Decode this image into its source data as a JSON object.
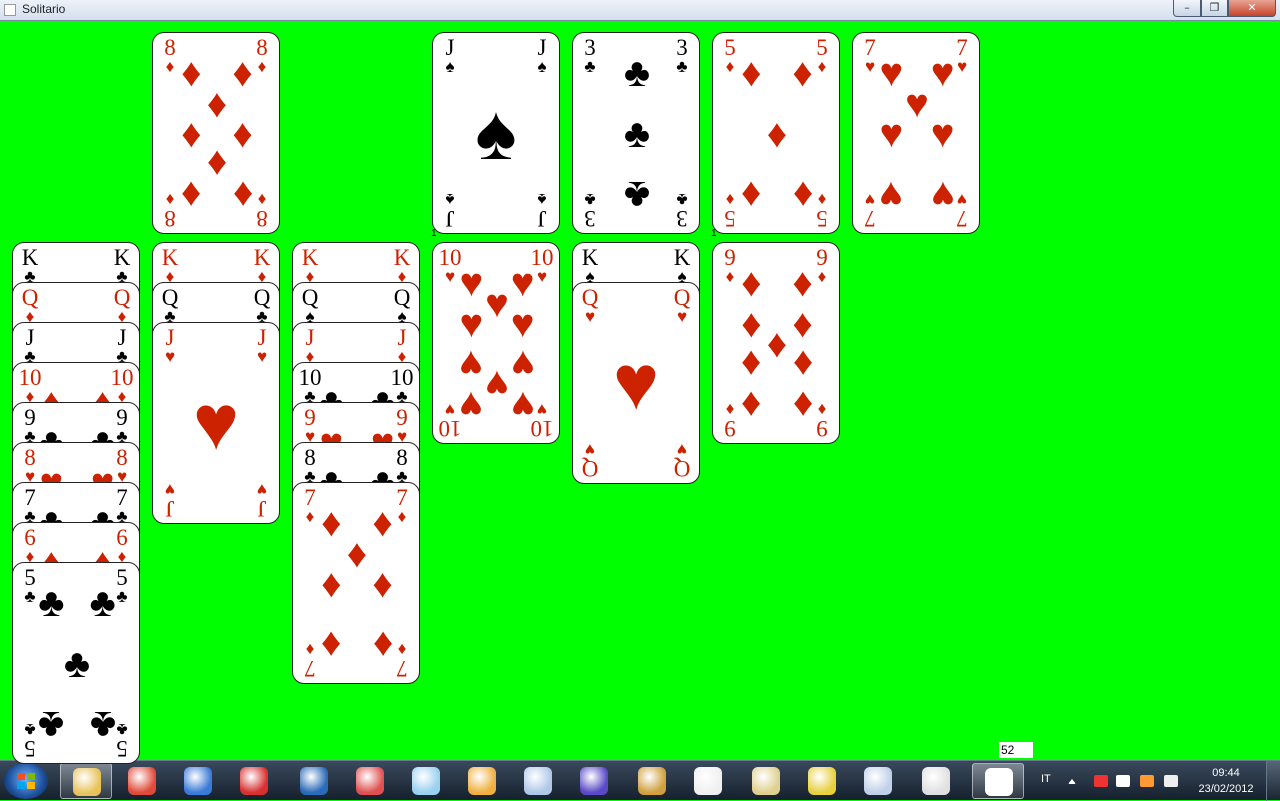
{
  "window": {
    "title": "Solitario",
    "minimize_icon": "minimize-icon",
    "maximize_icon": "restore-icon",
    "close_icon": "close-icon",
    "close_glyph": "✕",
    "min_glyph": "–",
    "max_glyph": "❐"
  },
  "colors": {
    "felt": "#00ff00",
    "red_suit": "#cc2200",
    "black_suit": "#000000"
  },
  "foundation": [
    {
      "rank": "8",
      "suit": "♦",
      "color": "red"
    },
    {
      "rank": "J",
      "suit": "♠",
      "color": "black",
      "count": "1"
    },
    {
      "rank": "3",
      "suit": "♣",
      "color": "black"
    },
    {
      "rank": "5",
      "suit": "♦",
      "color": "red",
      "count": "1"
    },
    {
      "rank": "7",
      "suit": "♥",
      "color": "red"
    }
  ],
  "tableau": [
    [
      {
        "rank": "K",
        "suit": "♣",
        "color": "black"
      },
      {
        "rank": "Q",
        "suit": "♦",
        "color": "red"
      },
      {
        "rank": "J",
        "suit": "♣",
        "color": "black"
      },
      {
        "rank": "10",
        "suit": "♦",
        "color": "red"
      },
      {
        "rank": "9",
        "suit": "♣",
        "color": "black"
      },
      {
        "rank": "8",
        "suit": "♥",
        "color": "red"
      },
      {
        "rank": "7",
        "suit": "♣",
        "color": "black"
      },
      {
        "rank": "6",
        "suit": "♦",
        "color": "red"
      },
      {
        "rank": "5",
        "suit": "♣",
        "color": "black"
      }
    ],
    [
      {
        "rank": "K",
        "suit": "♦",
        "color": "red"
      },
      {
        "rank": "Q",
        "suit": "♣",
        "color": "black"
      },
      {
        "rank": "J",
        "suit": "♥",
        "color": "red"
      }
    ],
    [
      {
        "rank": "K",
        "suit": "♦",
        "color": "red"
      },
      {
        "rank": "Q",
        "suit": "♠",
        "color": "black"
      },
      {
        "rank": "J",
        "suit": "♦",
        "color": "red"
      },
      {
        "rank": "10",
        "suit": "♣",
        "color": "black"
      },
      {
        "rank": "9",
        "suit": "♥",
        "color": "red"
      },
      {
        "rank": "8",
        "suit": "♣",
        "color": "black"
      },
      {
        "rank": "7",
        "suit": "♦",
        "color": "red"
      }
    ],
    [
      {
        "rank": "10",
        "suit": "♥",
        "color": "red"
      }
    ],
    [
      {
        "rank": "K",
        "suit": "♠",
        "color": "black"
      },
      {
        "rank": "Q",
        "suit": "♥",
        "color": "red"
      }
    ],
    [
      {
        "rank": "9",
        "suit": "♦",
        "color": "red"
      }
    ]
  ],
  "counter": "52",
  "taskbar": {
    "start_icon": "windows-start-icon",
    "apps": [
      {
        "name": "explorer-icon",
        "color": "#e8c25a"
      },
      {
        "name": "chrome-icon",
        "color": "#e04a3a"
      },
      {
        "name": "itunes-icon",
        "color": "#3a7ad8"
      },
      {
        "name": "red-app-icon",
        "color": "#d83030"
      },
      {
        "name": "blue-app-icon",
        "color": "#2a6ab8"
      },
      {
        "name": "audio-app-icon",
        "color": "#e05050"
      },
      {
        "name": "notepad-icon",
        "color": "#9ad0f0"
      },
      {
        "name": "paint-icon",
        "color": "#f0b040"
      },
      {
        "name": "cube-app-icon",
        "color": "#b0c8e8"
      },
      {
        "name": "bittorrent-icon",
        "color": "#5a4ac8"
      },
      {
        "name": "star-app-icon",
        "color": "#d0a040"
      },
      {
        "name": "cards-app-icon",
        "color": "#f0f0f0"
      },
      {
        "name": "hxd-icon",
        "color": "#e0d090"
      },
      {
        "name": "ruler-app-icon",
        "color": "#e8d040"
      },
      {
        "name": "calculator-icon",
        "color": "#c0d0e8"
      },
      {
        "name": "snipping-tool-icon",
        "color": "#e0e0e0"
      },
      {
        "name": "solitario-app-icon",
        "color": "#ffffff"
      }
    ],
    "language": "IT",
    "time": "09:44",
    "date": "23/02/2012",
    "tray_icons": [
      "tray-expand-icon",
      "network-icon",
      "power-icon",
      "security-icon",
      "volume-icon"
    ]
  }
}
